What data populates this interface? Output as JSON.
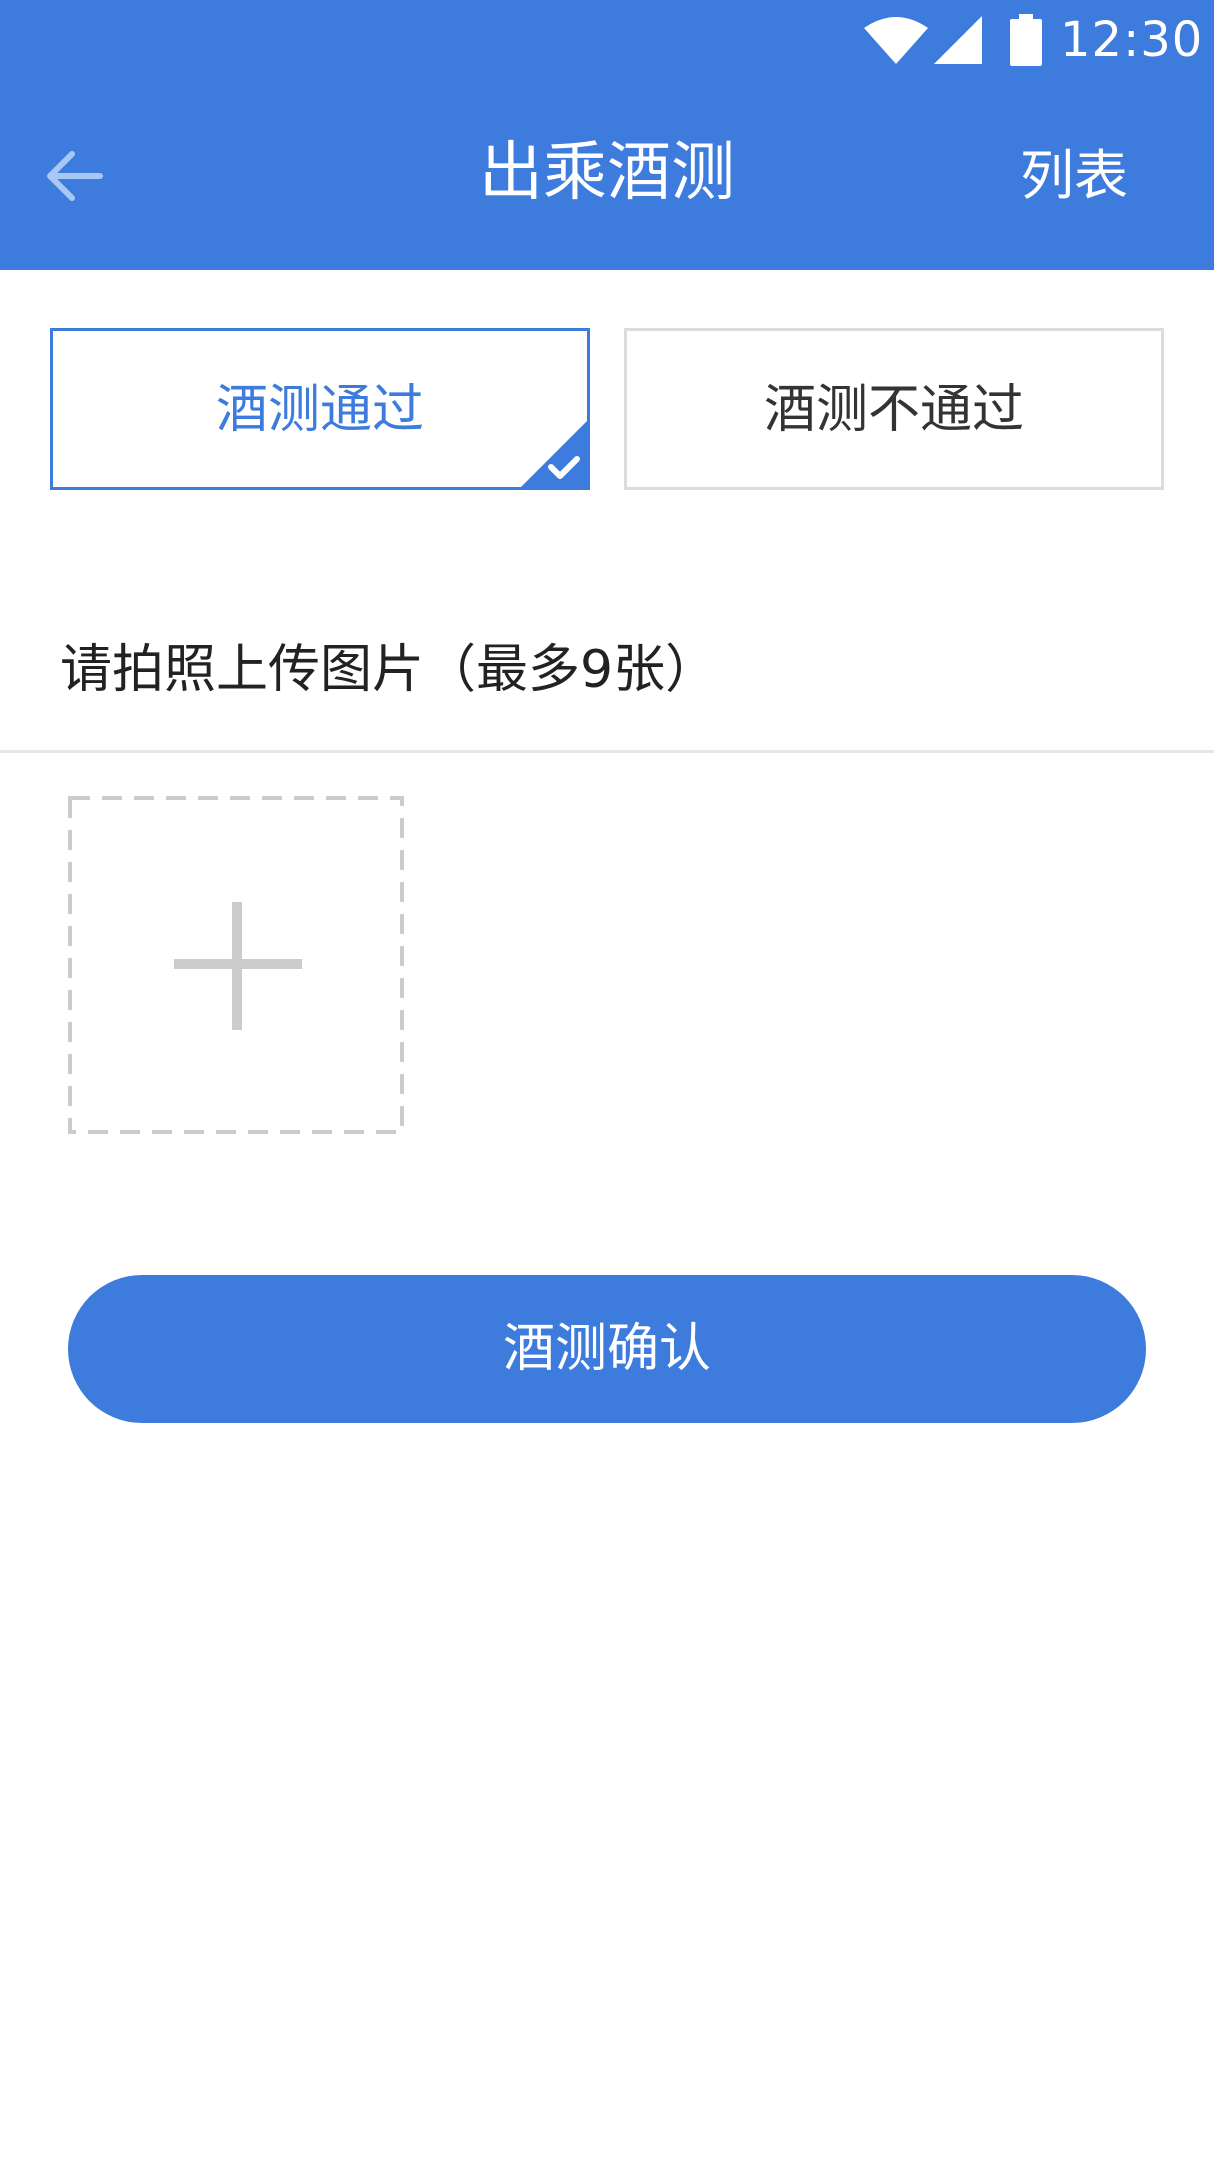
{
  "status_bar": {
    "time": "12:30",
    "icons": [
      "wifi-icon",
      "signal-icon",
      "battery-icon"
    ]
  },
  "header": {
    "back_icon": "arrow-left-icon",
    "title": "出乘酒测",
    "list_label": "列表"
  },
  "result_options": [
    {
      "label": "酒测通过",
      "selected": true
    },
    {
      "label": "酒测不通过",
      "selected": false
    }
  ],
  "upload": {
    "label": "请拍照上传图片（最多9张）",
    "add_icon": "plus-icon"
  },
  "confirm_label": "酒测确认",
  "colors": {
    "primary": "#3d7bdc",
    "text_dark": "#222222",
    "border_gray": "#dcdcdc",
    "placeholder_gray": "#cccccc",
    "background": "#ffffff"
  }
}
